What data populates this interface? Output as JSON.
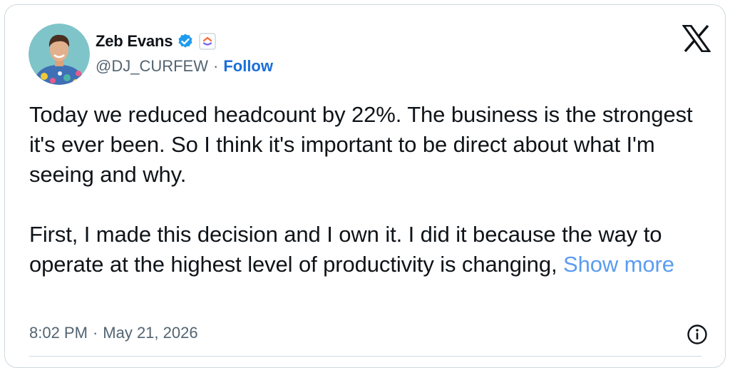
{
  "author": {
    "name": "Zeb Evans",
    "handle": "@DJ_CURFEW",
    "separator": "·",
    "follow_label": "Follow",
    "verified_color": "#1d9bf0"
  },
  "icons": {
    "avatar": "profile-photo",
    "verified": "verified-badge-icon",
    "affiliate": "clickup-logo-icon",
    "platform": "x-logo-icon",
    "info": "info-icon"
  },
  "tweet": {
    "paragraphs": [
      "Today we reduced headcount by 22%. The business is the strongest it's ever been. So I think it's important to be direct about what I'm seeing and why.",
      "First, I made this decision and I own it. I did it because the way to operate at the highest level of productivity is changing,"
    ],
    "show_more_label": "Show more",
    "time": "8:02 PM",
    "date": "May 21, 2026",
    "separator": "·"
  }
}
